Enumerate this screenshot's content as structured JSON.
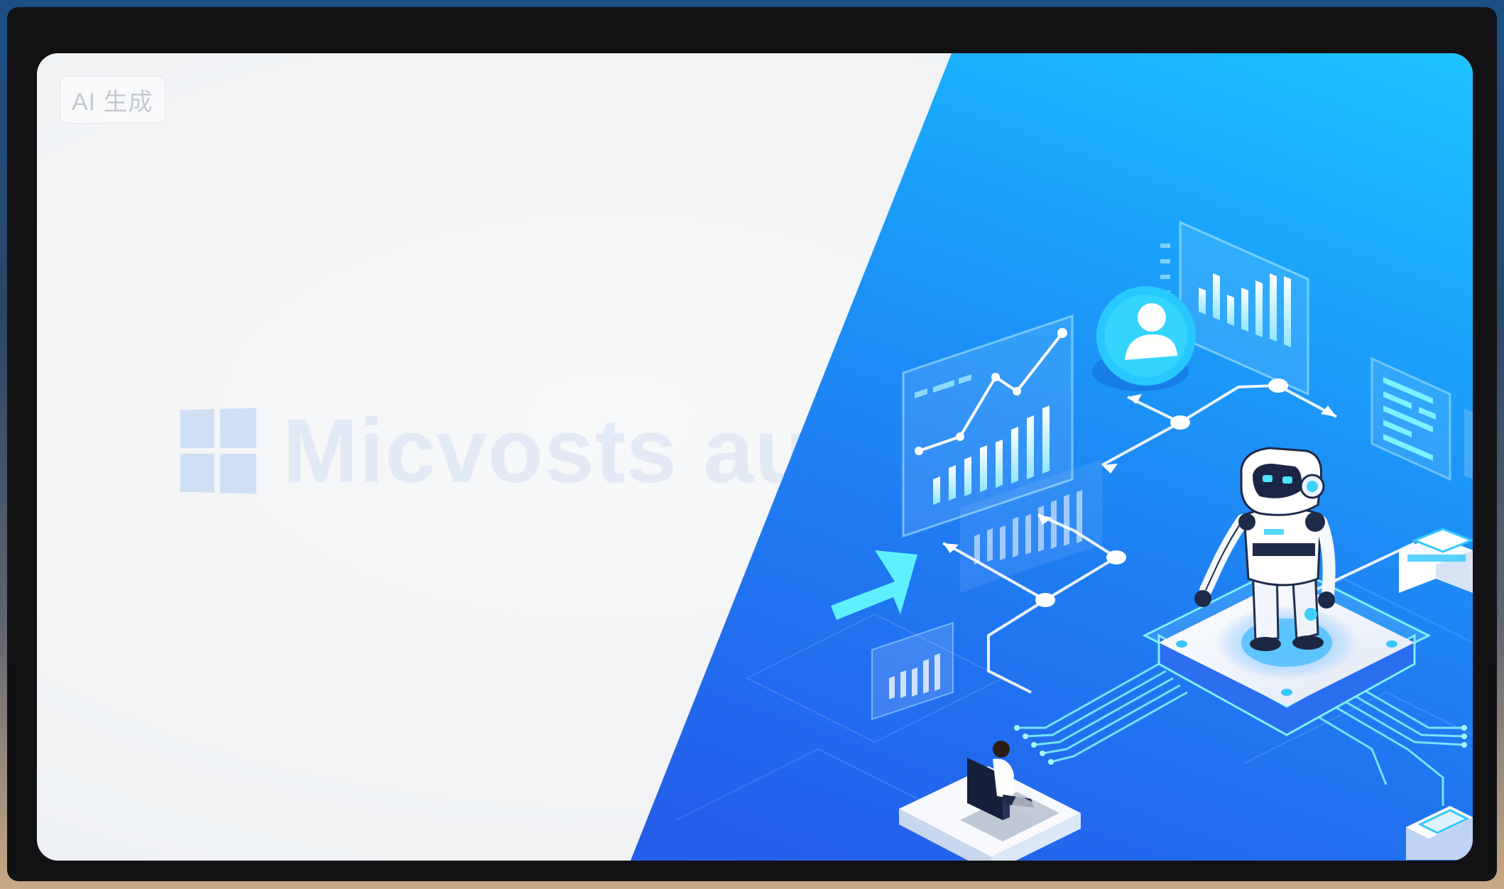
{
  "badge": {
    "label": "AI 生成"
  },
  "brand": {
    "text": "Micvosts auto",
    "logo_icon": "windows-logo-icon"
  },
  "icons": {
    "robot": "robot-icon",
    "user": "user-avatar-icon",
    "person": "person-at-desk-icon",
    "arrow": "arrow-icon"
  },
  "colors": {
    "panel_light": "#f3f5f7",
    "panel_blue_top": "#1ec3ff",
    "panel_blue_bottom": "#2a4fe4",
    "accent_cyan": "#6ff0ff",
    "frame": "#121214"
  }
}
